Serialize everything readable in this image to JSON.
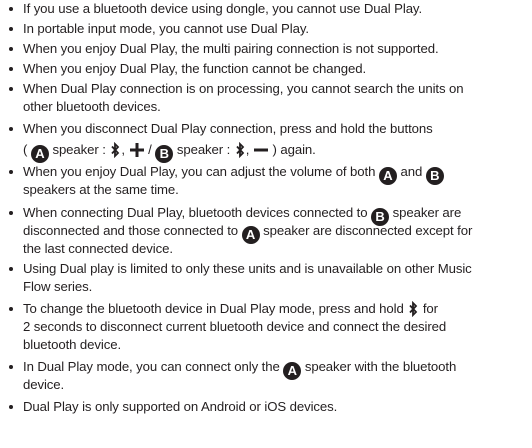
{
  "bullets": [
    {
      "text": "If you use a bluetooth device using dongle, you cannot use Dual Play."
    },
    {
      "text": "In portable input mode, you cannot use Dual Play."
    },
    {
      "text": "When you enjoy Dual Play, the multi pairing connection is not supported."
    },
    {
      "text": "When you enjoy Dual Play, the function cannot be changed."
    },
    {
      "line1": "When Dual Play connection is on processing, you cannot search the units on",
      "line2": "other bluetooth devices."
    },
    {
      "line1": "When you disconnect Dual Play connection, press and hold the buttons",
      "open_paren": "(",
      "speaker_a_label": "speaker :",
      "slash": "/",
      "speaker_b_label": "speaker :",
      "close": ") again."
    },
    {
      "line1_prefix": "When you enjoy Dual Play, you can adjust the volume of both",
      "and": "and",
      "line2": "speakers at the same time."
    },
    {
      "line1_prefix": "When connecting Dual Play, bluetooth devices connected to",
      "line1_suffix": "speaker are",
      "line2_prefix": "disconnected and those connected to",
      "line2_suffix": "speaker are disconnected except for",
      "line3": "the last connected device."
    },
    {
      "line1": "Using Dual play is limited to only these units and is unavailable on other Music",
      "line2": "Flow series."
    },
    {
      "line1_prefix": "To change the bluetooth device in Dual Play mode, press and hold",
      "line1_suffix": "for",
      "line2": "2 seconds to disconnect current bluetooth device and connect the desired",
      "line3": "bluetooth device."
    },
    {
      "line1_prefix": "In Dual Play mode, you can connect only the",
      "line1_suffix": "speaker with the bluetooth",
      "line2": "device."
    },
    {
      "text": "Dual Play is only supported on Android or iOS devices."
    }
  ],
  "badges": {
    "a": "A",
    "b": "B"
  },
  "icons": {
    "bluetooth": "bluetooth-icon",
    "plus": "plus-icon",
    "minus": "minus-icon"
  },
  "colors": {
    "text": "#231f20",
    "badge_bg": "#231f20",
    "badge_fg": "#ffffff"
  }
}
